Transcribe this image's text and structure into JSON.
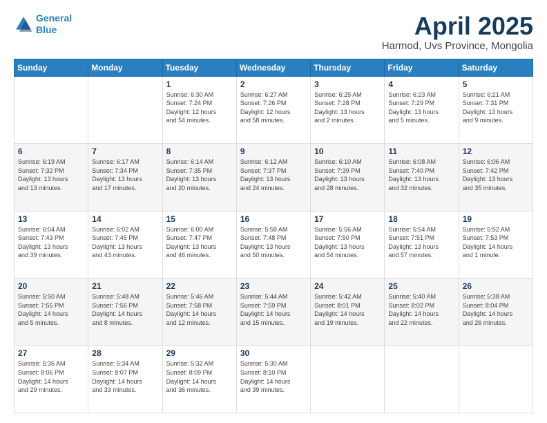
{
  "header": {
    "logo_line1": "General",
    "logo_line2": "Blue",
    "title": "April 2025",
    "subtitle": "Harmod, Uvs Province, Mongolia"
  },
  "days_of_week": [
    "Sunday",
    "Monday",
    "Tuesday",
    "Wednesday",
    "Thursday",
    "Friday",
    "Saturday"
  ],
  "weeks": [
    [
      {
        "day": "",
        "info": ""
      },
      {
        "day": "",
        "info": ""
      },
      {
        "day": "1",
        "info": "Sunrise: 6:30 AM\nSunset: 7:24 PM\nDaylight: 12 hours\nand 54 minutes."
      },
      {
        "day": "2",
        "info": "Sunrise: 6:27 AM\nSunset: 7:26 PM\nDaylight: 12 hours\nand 58 minutes."
      },
      {
        "day": "3",
        "info": "Sunrise: 6:25 AM\nSunset: 7:28 PM\nDaylight: 13 hours\nand 2 minutes."
      },
      {
        "day": "4",
        "info": "Sunrise: 6:23 AM\nSunset: 7:29 PM\nDaylight: 13 hours\nand 5 minutes."
      },
      {
        "day": "5",
        "info": "Sunrise: 6:21 AM\nSunset: 7:31 PM\nDaylight: 13 hours\nand 9 minutes."
      }
    ],
    [
      {
        "day": "6",
        "info": "Sunrise: 6:19 AM\nSunset: 7:32 PM\nDaylight: 13 hours\nand 13 minutes."
      },
      {
        "day": "7",
        "info": "Sunrise: 6:17 AM\nSunset: 7:34 PM\nDaylight: 13 hours\nand 17 minutes."
      },
      {
        "day": "8",
        "info": "Sunrise: 6:14 AM\nSunset: 7:35 PM\nDaylight: 13 hours\nand 20 minutes."
      },
      {
        "day": "9",
        "info": "Sunrise: 6:12 AM\nSunset: 7:37 PM\nDaylight: 13 hours\nand 24 minutes."
      },
      {
        "day": "10",
        "info": "Sunrise: 6:10 AM\nSunset: 7:39 PM\nDaylight: 13 hours\nand 28 minutes."
      },
      {
        "day": "11",
        "info": "Sunrise: 6:08 AM\nSunset: 7:40 PM\nDaylight: 13 hours\nand 32 minutes."
      },
      {
        "day": "12",
        "info": "Sunrise: 6:06 AM\nSunset: 7:42 PM\nDaylight: 13 hours\nand 35 minutes."
      }
    ],
    [
      {
        "day": "13",
        "info": "Sunrise: 6:04 AM\nSunset: 7:43 PM\nDaylight: 13 hours\nand 39 minutes."
      },
      {
        "day": "14",
        "info": "Sunrise: 6:02 AM\nSunset: 7:45 PM\nDaylight: 13 hours\nand 43 minutes."
      },
      {
        "day": "15",
        "info": "Sunrise: 6:00 AM\nSunset: 7:47 PM\nDaylight: 13 hours\nand 46 minutes."
      },
      {
        "day": "16",
        "info": "Sunrise: 5:58 AM\nSunset: 7:48 PM\nDaylight: 13 hours\nand 50 minutes."
      },
      {
        "day": "17",
        "info": "Sunrise: 5:56 AM\nSunset: 7:50 PM\nDaylight: 13 hours\nand 54 minutes."
      },
      {
        "day": "18",
        "info": "Sunrise: 5:54 AM\nSunset: 7:51 PM\nDaylight: 13 hours\nand 57 minutes."
      },
      {
        "day": "19",
        "info": "Sunrise: 5:52 AM\nSunset: 7:53 PM\nDaylight: 14 hours\nand 1 minute."
      }
    ],
    [
      {
        "day": "20",
        "info": "Sunrise: 5:50 AM\nSunset: 7:55 PM\nDaylight: 14 hours\nand 5 minutes."
      },
      {
        "day": "21",
        "info": "Sunrise: 5:48 AM\nSunset: 7:56 PM\nDaylight: 14 hours\nand 8 minutes."
      },
      {
        "day": "22",
        "info": "Sunrise: 5:46 AM\nSunset: 7:58 PM\nDaylight: 14 hours\nand 12 minutes."
      },
      {
        "day": "23",
        "info": "Sunrise: 5:44 AM\nSunset: 7:59 PM\nDaylight: 14 hours\nand 15 minutes."
      },
      {
        "day": "24",
        "info": "Sunrise: 5:42 AM\nSunset: 8:01 PM\nDaylight: 14 hours\nand 19 minutes."
      },
      {
        "day": "25",
        "info": "Sunrise: 5:40 AM\nSunset: 8:02 PM\nDaylight: 14 hours\nand 22 minutes."
      },
      {
        "day": "26",
        "info": "Sunrise: 5:38 AM\nSunset: 8:04 PM\nDaylight: 14 hours\nand 26 minutes."
      }
    ],
    [
      {
        "day": "27",
        "info": "Sunrise: 5:36 AM\nSunset: 8:06 PM\nDaylight: 14 hours\nand 29 minutes."
      },
      {
        "day": "28",
        "info": "Sunrise: 5:34 AM\nSunset: 8:07 PM\nDaylight: 14 hours\nand 33 minutes."
      },
      {
        "day": "29",
        "info": "Sunrise: 5:32 AM\nSunset: 8:09 PM\nDaylight: 14 hours\nand 36 minutes."
      },
      {
        "day": "30",
        "info": "Sunrise: 5:30 AM\nSunset: 8:10 PM\nDaylight: 14 hours\nand 39 minutes."
      },
      {
        "day": "",
        "info": ""
      },
      {
        "day": "",
        "info": ""
      },
      {
        "day": "",
        "info": ""
      }
    ]
  ]
}
